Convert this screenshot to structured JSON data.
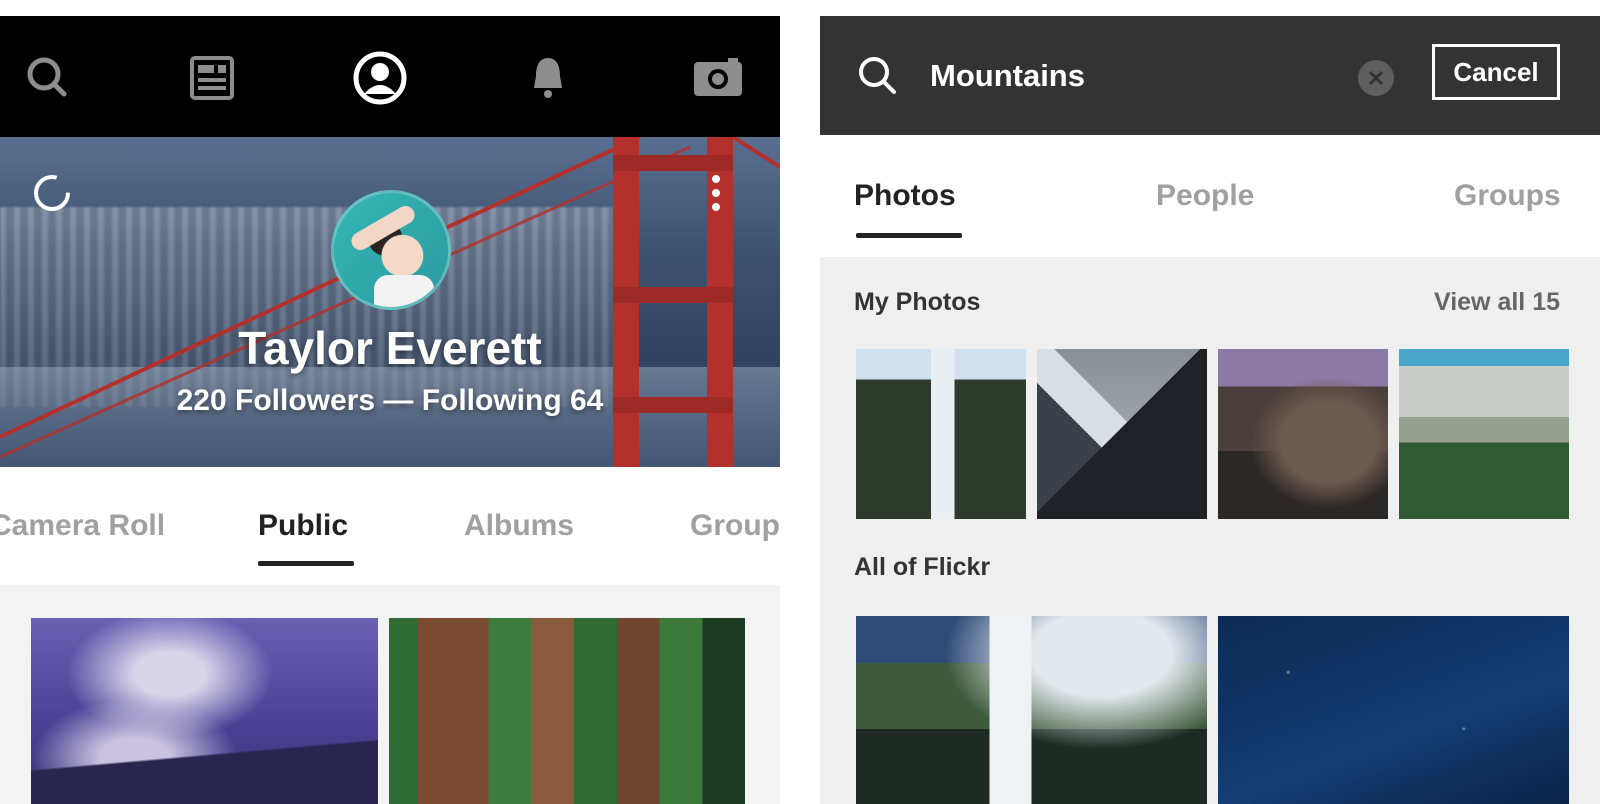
{
  "left_screen": {
    "nav": {
      "items": [
        "search-icon",
        "feed-icon",
        "profile-icon",
        "notifications-icon",
        "camera-icon"
      ]
    },
    "profile": {
      "name": "Taylor Everett",
      "stats": "220 Followers — Following 64"
    },
    "tabs": [
      "Camera Roll",
      "Public",
      "Albums",
      "Groups"
    ],
    "active_tab": "Public",
    "photos": [
      "purple-mountain-sky",
      "redwood-forest"
    ]
  },
  "right_screen": {
    "search": {
      "query": "Mountains",
      "cancel_label": "Cancel"
    },
    "tabs": [
      "Photos",
      "People",
      "Groups"
    ],
    "active_tab": "Photos",
    "my_photos": {
      "title": "My Photos",
      "link": "View all 15",
      "thumbnails": [
        "waterfall",
        "snowy-peak",
        "half-dome",
        "granite-cliff"
      ]
    },
    "all_of_flickr": {
      "title": "All of Flickr",
      "thumbnails": [
        "yosemite-falls",
        "night-sky"
      ]
    }
  },
  "colors": {
    "nav_bg": "#000000",
    "search_bg": "#333333",
    "active_text": "#222222",
    "inactive_text": "#a0a0a0",
    "bridge_red": "#b3302c",
    "avatar_teal": "#36b6b4"
  }
}
